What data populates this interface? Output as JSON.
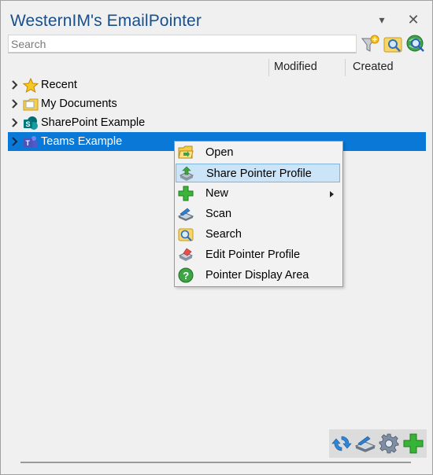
{
  "window": {
    "title": "WesternIM's EmailPointer",
    "dropdown_glyph": "▾",
    "close_glyph": "✕"
  },
  "search": {
    "placeholder": "Search",
    "value": ""
  },
  "toolbar_icons": [
    "filter-star-icon",
    "search-folder-icon",
    "globe-search-icon"
  ],
  "columns": {
    "modified": "Modified",
    "created": "Created"
  },
  "tree": {
    "items": [
      {
        "label": "Recent",
        "icon": "star-icon"
      },
      {
        "label": "My Documents",
        "icon": "folder-documents-icon"
      },
      {
        "label": "SharePoint Example",
        "icon": "sharepoint-icon"
      },
      {
        "label": "Teams Example",
        "icon": "teams-icon",
        "selected": true
      }
    ]
  },
  "context_menu": {
    "items": [
      {
        "label": "Open",
        "icon": "open-folder-icon"
      },
      {
        "label": "Share Pointer Profile",
        "icon": "share-profile-icon",
        "highlighted": true
      },
      {
        "label": "New",
        "icon": "plus-icon",
        "submenu": true
      },
      {
        "label": "Scan",
        "icon": "scanner-icon"
      },
      {
        "label": "Search",
        "icon": "search-icon"
      },
      {
        "label": "Edit Pointer Profile",
        "icon": "edit-profile-icon"
      },
      {
        "label": "Pointer Display Area",
        "icon": "help-icon"
      }
    ]
  },
  "bottom_toolbar": [
    "refresh-icon",
    "scanner-icon",
    "gear-icon",
    "add-icon"
  ],
  "colors": {
    "title": "#1a4f8a",
    "selection": "#0a78d7",
    "menu_highlight": "#cce4f7"
  }
}
